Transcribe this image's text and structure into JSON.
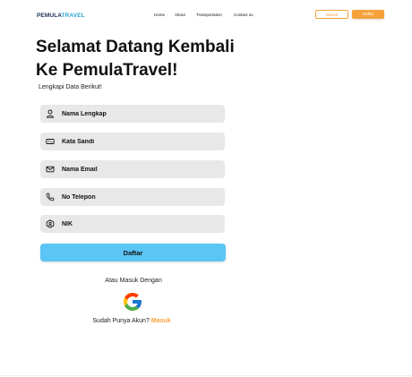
{
  "nav": {
    "logo_part1": "PEMULA",
    "logo_part2": "TRAVEL",
    "links": [
      "Home",
      "About",
      "Transportation",
      "Contact us"
    ],
    "masuk_label": "Masuk",
    "daftar_label": "Daftar"
  },
  "hero": {
    "title_line1": "Selamat Datang Kembali",
    "title_line2": "Ke PemulaTravel!",
    "subtitle": "Lengkapi Data Berikut!"
  },
  "form": {
    "fields": [
      {
        "placeholder": "Nama Lengkap",
        "icon": "user-icon"
      },
      {
        "placeholder": "Kata Sandi",
        "icon": "password-icon"
      },
      {
        "placeholder": "Nama Email",
        "icon": "mail-icon"
      },
      {
        "placeholder": "No Telepon",
        "icon": "phone-icon"
      },
      {
        "placeholder": "NIK",
        "icon": "id-icon"
      }
    ],
    "submit_label": "Daftar"
  },
  "alt": {
    "or_text": "Atau Masuk Dengan",
    "have_account": "Sudah Punya Akun?",
    "login_link": "Masuk"
  },
  "colors": {
    "accent": "#f6a23a",
    "primary": "#5bc5f5",
    "field_bg": "#e8e8e8"
  }
}
